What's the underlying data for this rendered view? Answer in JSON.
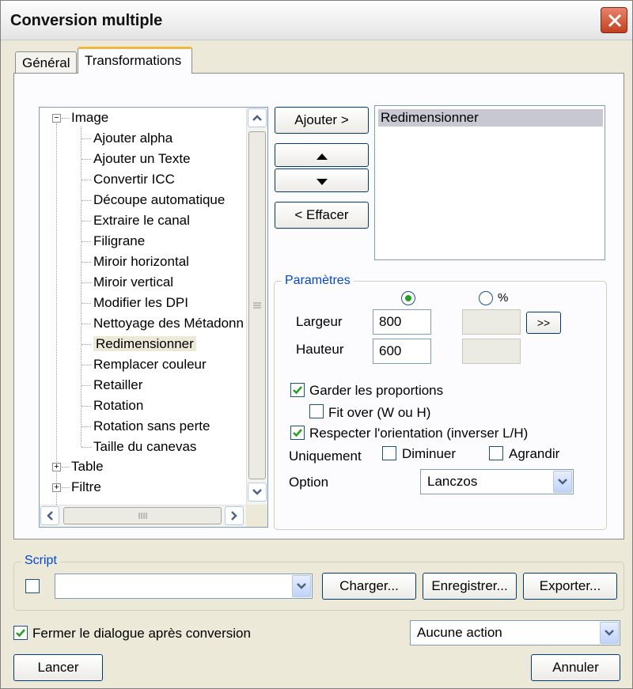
{
  "window": {
    "title": "Conversion multiple"
  },
  "tabs": [
    {
      "label": "Général"
    },
    {
      "label": "Transformations"
    }
  ],
  "tree": {
    "groups": [
      {
        "label": "Image",
        "expander": "−",
        "items": [
          "Ajouter alpha",
          "Ajouter un Texte",
          "Convertir ICC",
          "Découpe automatique",
          "Extraire le canal",
          "Filigrane",
          "Miroir horizontal",
          "Miroir vertical",
          "Modifier les DPI",
          "Nettoyage des Métadonn",
          "Redimensionner",
          "Remplacer couleur",
          "Retailler",
          "Rotation",
          "Rotation sans perte",
          "Taille du canevas"
        ]
      },
      {
        "label": "Table",
        "expander": "+"
      },
      {
        "label": "Filtre",
        "expander": "+"
      }
    ],
    "selected_item": "Redimensionner"
  },
  "actions": {
    "add_label": "Ajouter >",
    "remove_label": "< Effacer"
  },
  "applied_list": [
    "Redimensionner"
  ],
  "params": {
    "legend": "Paramètres",
    "percent_label": "%",
    "width_label": "Largeur",
    "width_value": "800",
    "height_label": "Hauteur",
    "height_value": "600",
    "more_label": ">>",
    "keep_ratio_label": "Garder les proportions",
    "fit_over_label": "Fit over (W ou H)",
    "orientation_label": "Respecter l'orientation (inverser L/H)",
    "only_label": "Uniquement",
    "decrease_label": "Diminuer",
    "enlarge_label": "Agrandir",
    "option_label": "Option",
    "option_value": "Lanczos"
  },
  "script": {
    "legend": "Script",
    "value": "",
    "load_label": "Charger...",
    "save_label": "Enregistrer...",
    "export_label": "Exporter..."
  },
  "footer": {
    "close_after_label": "Fermer le dialogue après conversion",
    "after_action_value": "Aucune action",
    "run_label": "Lancer",
    "cancel_label": "Annuler"
  }
}
